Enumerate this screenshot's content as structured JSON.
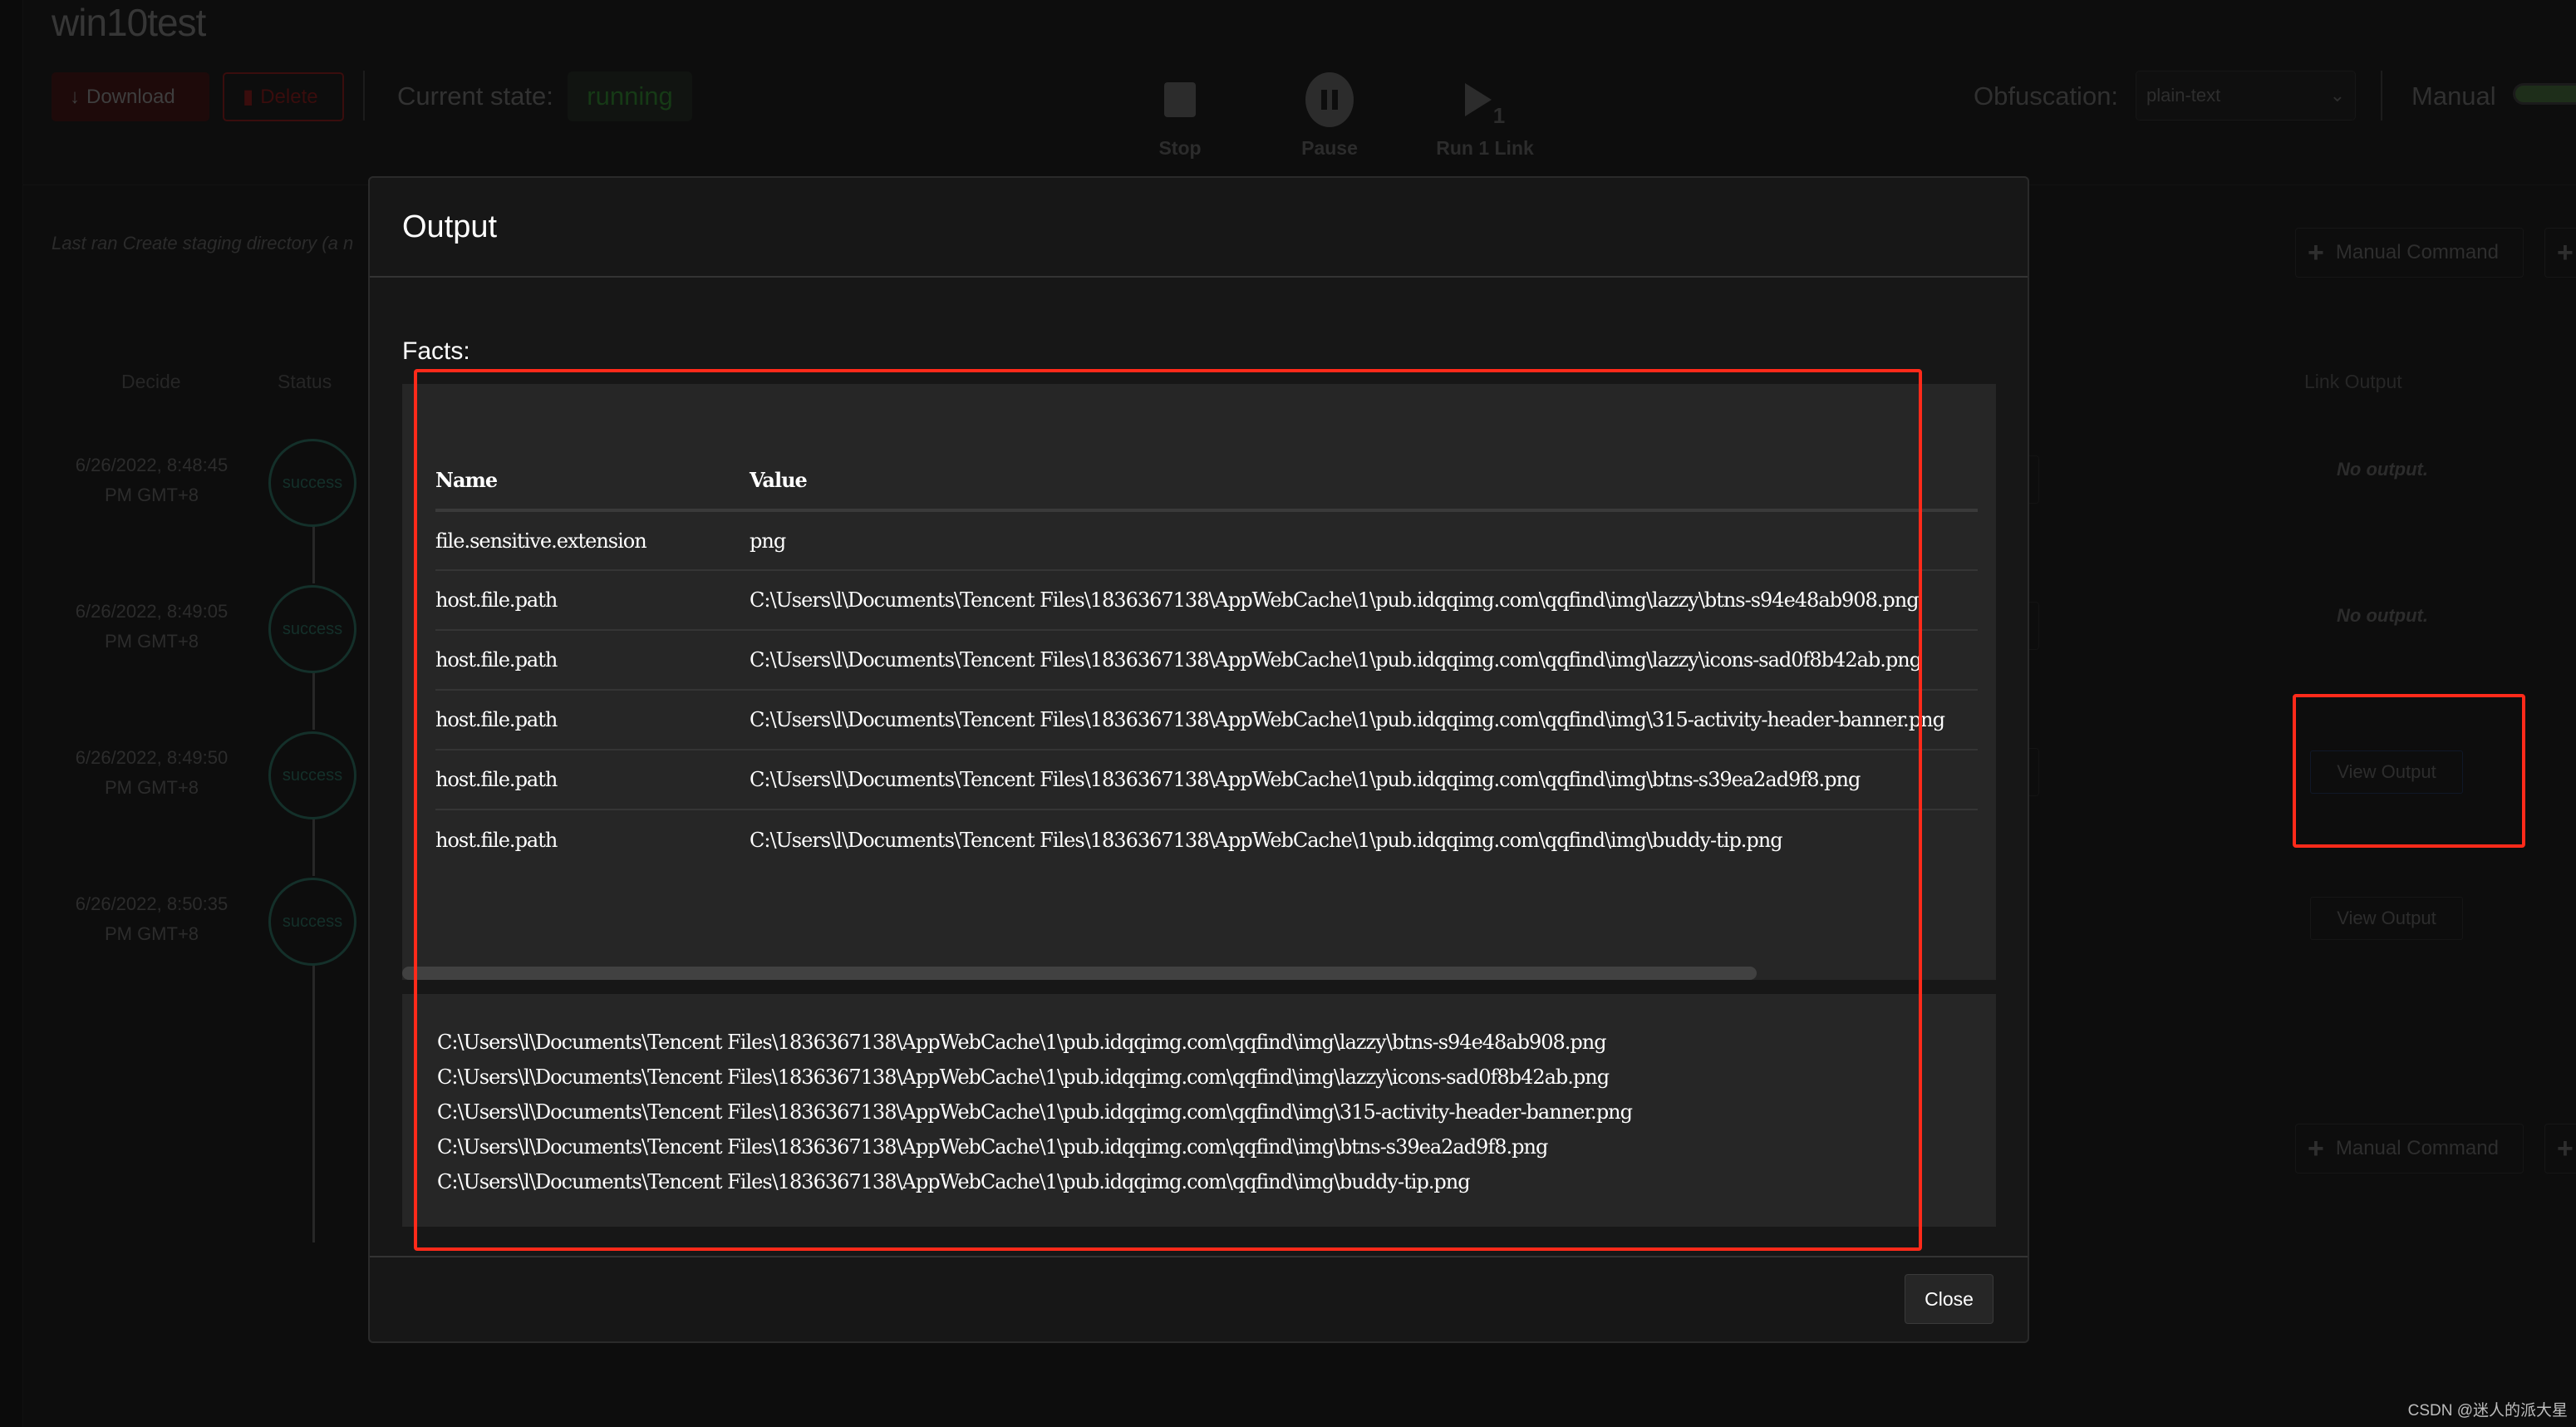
{
  "operation": {
    "title": "win10test",
    "download_label": "Download",
    "delete_label": "Delete",
    "state_label": "Current state:",
    "state_value": "running",
    "controls": {
      "stop": "Stop",
      "pause": "Pause",
      "run_one": "Run 1 Link",
      "run_one_sub": "1"
    },
    "obfuscation_label": "Obfuscation:",
    "obfuscation_value": "plain-text",
    "manual_label": "Manual",
    "manual_enabled": true,
    "last_ran": "Last ran Create staging directory (a n",
    "manual_command_label": "Manual Command",
    "columns": {
      "decide": "Decide",
      "status": "Status",
      "link_output": "Link Output"
    },
    "links": [
      {
        "date": "6/26/2022, 8:48:45",
        "tz": "PM GMT+8",
        "status": "success",
        "output": "No output."
      },
      {
        "date": "6/26/2022, 8:49:05",
        "tz": "PM GMT+8",
        "status": "success",
        "output": "No output."
      },
      {
        "date": "6/26/2022, 8:49:50",
        "tz": "PM GMT+8",
        "status": "success",
        "output": "View Output"
      },
      {
        "date": "6/26/2022, 8:50:35",
        "tz": "PM GMT+8",
        "status": "success",
        "output": "View Output"
      }
    ]
  },
  "modal": {
    "title": "Output",
    "facts_label": "Facts:",
    "table": {
      "headers": [
        "Name",
        "Value"
      ],
      "rows": [
        {
          "name": "file.sensitive.extension",
          "value": "png"
        },
        {
          "name": "host.file.path",
          "value": "C:\\Users\\l\\Documents\\Tencent Files\\1836367138\\AppWebCache\\1\\pub.idqqimg.com\\qqfind\\img\\lazzy\\btns-s94e48ab908.png"
        },
        {
          "name": "host.file.path",
          "value": "C:\\Users\\l\\Documents\\Tencent Files\\1836367138\\AppWebCache\\1\\pub.idqqimg.com\\qqfind\\img\\lazzy\\icons-sad0f8b42ab.png"
        },
        {
          "name": "host.file.path",
          "value": "C:\\Users\\l\\Documents\\Tencent Files\\1836367138\\AppWebCache\\1\\pub.idqqimg.com\\qqfind\\img\\315-activity-header-banner.png"
        },
        {
          "name": "host.file.path",
          "value": "C:\\Users\\l\\Documents\\Tencent Files\\1836367138\\AppWebCache\\1\\pub.idqqimg.com\\qqfind\\img\\btns-s39ea2ad9f8.png"
        },
        {
          "name": "host.file.path",
          "value": "C:\\Users\\l\\Documents\\Tencent Files\\1836367138\\AppWebCache\\1\\pub.idqqimg.com\\qqfind\\img\\buddy-tip.png"
        }
      ],
      "horizontal_scroll_position": 0,
      "horizontal_scroll_visible_fraction": 0.85
    },
    "raw_output": [
      "C:\\Users\\l\\Documents\\Tencent Files\\1836367138\\AppWebCache\\1\\pub.idqqimg.com\\qqfind\\img\\lazzy\\btns-s94e48ab908.png",
      "C:\\Users\\l\\Documents\\Tencent Files\\1836367138\\AppWebCache\\1\\pub.idqqimg.com\\qqfind\\img\\lazzy\\icons-sad0f8b42ab.png",
      "C:\\Users\\l\\Documents\\Tencent Files\\1836367138\\AppWebCache\\1\\pub.idqqimg.com\\qqfind\\img\\315-activity-header-banner.png",
      "C:\\Users\\l\\Documents\\Tencent Files\\1836367138\\AppWebCache\\1\\pub.idqqimg.com\\qqfind\\img\\btns-s39ea2ad9f8.png",
      "C:\\Users\\l\\Documents\\Tencent Files\\1836367138\\AppWebCache\\1\\pub.idqqimg.com\\qqfind\\img\\buddy-tip.png"
    ],
    "close_label": "Close"
  },
  "colors": {
    "annotation": "#ff2a1a",
    "modal_bg": "#171717",
    "panel_bg": "#262626",
    "success": "#14302a"
  },
  "watermark": "CSDN @迷人的派大星"
}
